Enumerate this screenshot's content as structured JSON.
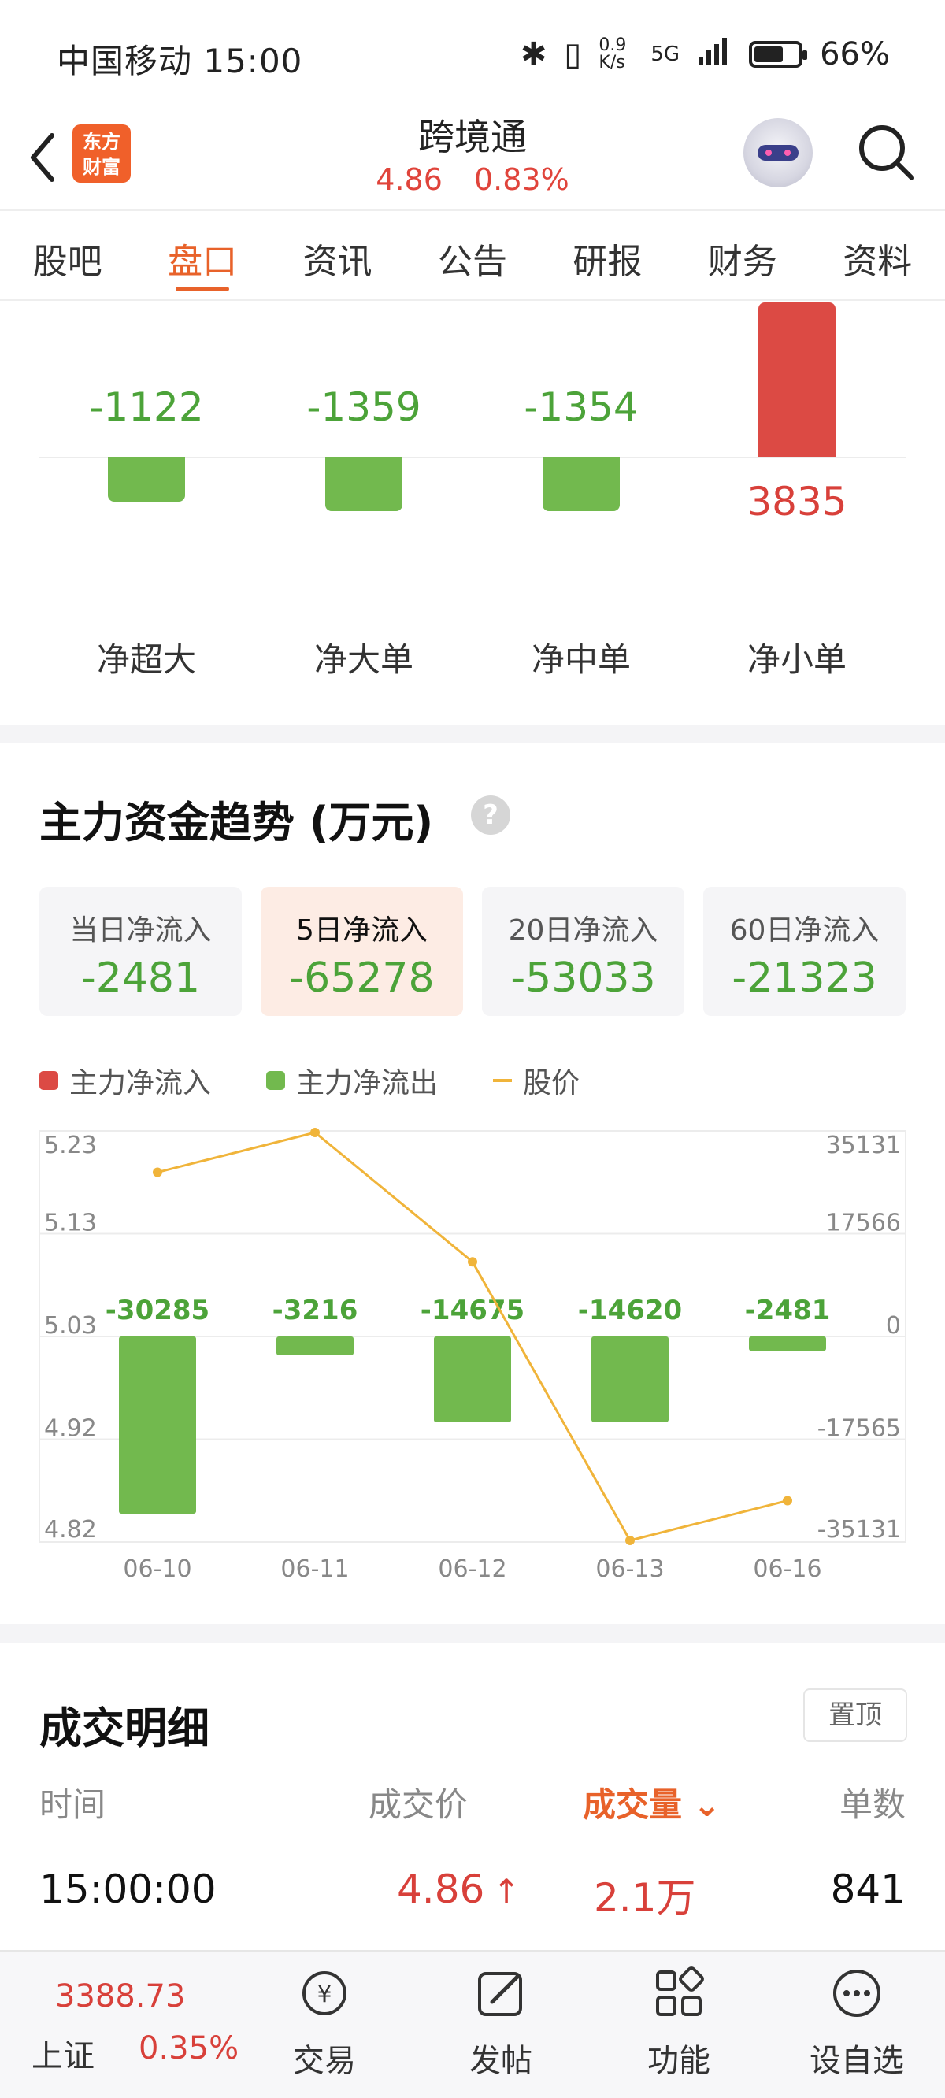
{
  "status_bar": {
    "carrier_time": "中国移动 15:00",
    "net_speed": "0.9 K/s",
    "network": "5G",
    "battery": "66%",
    "battery_level": 0.66
  },
  "header": {
    "logo": "东方财富",
    "title": "跨境通",
    "price": "4.86",
    "change_pct": "0.83%"
  },
  "tabs": [
    {
      "label": "股吧"
    },
    {
      "label": "盘口"
    },
    {
      "label": "资讯"
    },
    {
      "label": "公告"
    },
    {
      "label": "研报"
    },
    {
      "label": "财务"
    },
    {
      "label": "资料"
    }
  ],
  "active_tab": "盘口",
  "net_flow": {
    "items": [
      {
        "label": "净超大",
        "value": -1122
      },
      {
        "label": "净大单",
        "value": -1359
      },
      {
        "label": "净中单",
        "value": -1354
      },
      {
        "label": "净小单",
        "value": 3835
      }
    ],
    "value_texts": [
      "-1122",
      "-1359",
      "-1354",
      "3835"
    ]
  },
  "trend": {
    "title": "主力资金趋势 (万元)",
    "help": "?",
    "cards": [
      {
        "label": "当日净流入",
        "value": "-2481"
      },
      {
        "label": "5日净流入",
        "value": "-65278"
      },
      {
        "label": "20日净流入",
        "value": "-53033"
      },
      {
        "label": "60日净流入",
        "value": "-21323"
      }
    ],
    "active_card": "5日净流入",
    "legend": [
      "主力净流入",
      "主力净流出",
      "股价"
    ],
    "colors": {
      "inflow": "#dc4a44",
      "outflow": "#72b94e",
      "price": "#f0b43a"
    }
  },
  "chart_data": {
    "type": "bar",
    "categories": [
      "06-10",
      "06-11",
      "06-12",
      "06-13",
      "06-16"
    ],
    "series": [
      {
        "name": "主力净流出",
        "values": [
          -30285,
          -3216,
          -14675,
          -14620,
          -2481
        ]
      },
      {
        "name": "股价",
        "values": [
          5.19,
          5.23,
          5.1,
          4.82,
          4.86
        ]
      }
    ],
    "left_axis_ticks": [
      "5.23",
      "5.13",
      "5.03",
      "4.92",
      "4.82"
    ],
    "right_axis_ticks": [
      "35131",
      "17566",
      "0",
      "-17565",
      "-35131"
    ],
    "y_left_lim": [
      4.82,
      5.23
    ],
    "y_right_lim": [
      -35131,
      35131
    ],
    "bar_labels": [
      "-30285",
      "-3216",
      "-14675",
      "-14620",
      "-2481"
    ],
    "grid": true,
    "legend_position": "top-left"
  },
  "detail": {
    "title": "成交明细",
    "pin_label": "置顶",
    "columns": [
      "时间",
      "成交价",
      "成交量",
      "单数"
    ],
    "rows": [
      {
        "time": "15:00:00",
        "price": "4.86",
        "volume": "2.1万",
        "count": "841"
      }
    ]
  },
  "bottom_bar": {
    "index_value": "3388.73",
    "index_name": "上证",
    "index_pct": "0.35%",
    "items": [
      "交易",
      "发帖",
      "功能",
      "设自选"
    ]
  }
}
